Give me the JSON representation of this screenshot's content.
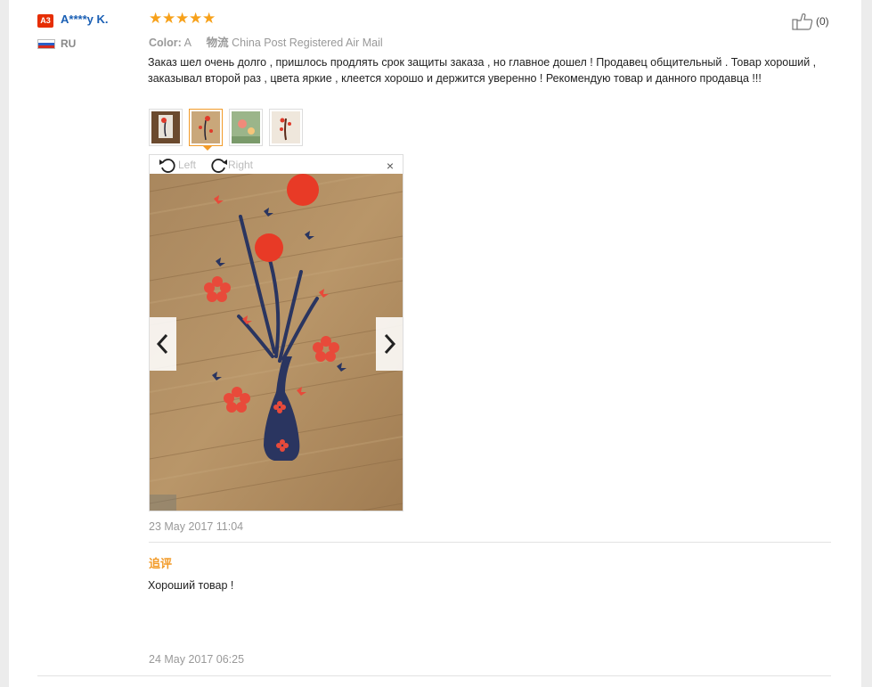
{
  "reviewer": {
    "badge": "A3",
    "name": "A****y K.",
    "country": "RU"
  },
  "rating": {
    "stars": 5,
    "max": 5,
    "glyph": "★"
  },
  "helpful": {
    "count_label": "(0)"
  },
  "meta": {
    "color_label": "Color:",
    "color_value": "A",
    "shipping_label": "物流",
    "shipping_value": "China Post Registered Air Mail"
  },
  "review_text": "Заказ шел очень долго , пришлось продлять срок защиты заказа , но главное дошел ! Продавец общительный . Товар хороший , заказывал второй раз , цвета яркие , клеется хорошо и держится уверенно ! Рекомендую товар и данного продавца !!!",
  "viewer": {
    "rotate_left_label": "Left",
    "rotate_right_label": "Right",
    "close_label": "×",
    "selected_photo_index": 2
  },
  "review_date": "23 May 2017 11:04",
  "followup": {
    "title": "追评",
    "text": "Хороший товар !",
    "date": "24 May 2017 06:25"
  },
  "colors": {
    "accent": "#f29b29",
    "star": "#f7a11a",
    "username": "#1a5fb4",
    "badge": "#e62e04",
    "muted": "#999999"
  }
}
